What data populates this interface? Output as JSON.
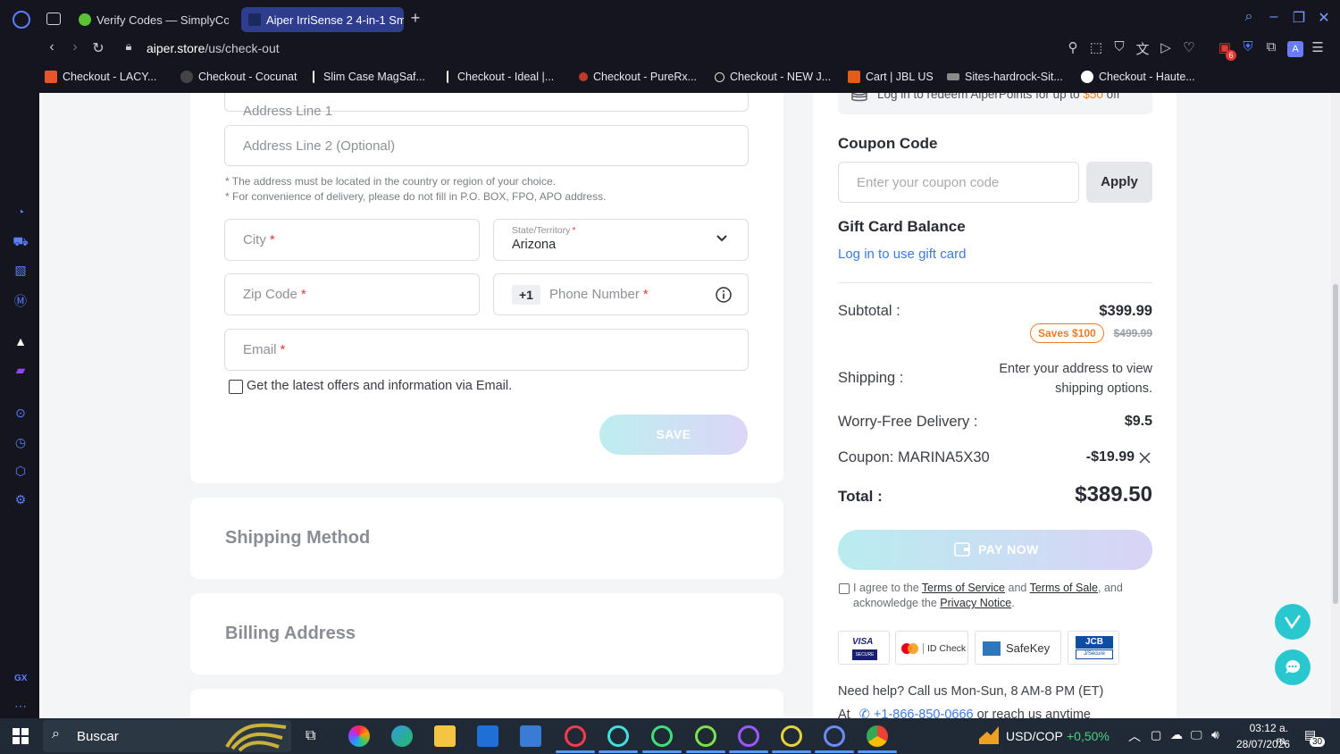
{
  "browser": {
    "tabs": [
      {
        "label": "Verify Codes — SimplyCod",
        "active": false
      },
      {
        "label": "Aiper IrriSense 2 4-in-1 Sm",
        "active": true
      }
    ],
    "url_host": "aiper.store",
    "url_path": "/us/check-out",
    "bookmarks": [
      "Checkout - LACY...",
      "Checkout - Cocunat",
      "Slim Case MagSaf...",
      "Checkout - Ideal |...",
      "Checkout - PureRx...",
      "Checkout - NEW J...",
      "Cart | JBL US",
      "Sites-hardrock-Sit...",
      "Checkout - Haute..."
    ],
    "ext_badge": "6",
    "profile": "A"
  },
  "form": {
    "address1_placeholder": "Address Line 1",
    "address2_placeholder": "Address Line 2 (Optional)",
    "note1": "* The address must be located in the country or region of your choice.",
    "note2": "* For convenience of delivery, please do not fill in P.O. BOX, FPO, APO address.",
    "city_placeholder": "City",
    "state_label": "State/Territory",
    "state_value": "Arizona",
    "zip_placeholder": "Zip Code",
    "phone_prefix": "+1",
    "phone_placeholder": "Phone Number",
    "email_placeholder": "Email",
    "required_mark": "*",
    "offers_label": "Get the latest offers and information via Email.",
    "save_label": "SAVE"
  },
  "sections": {
    "shipping_method": "Shipping Method",
    "billing_address": "Billing Address"
  },
  "summary": {
    "points_text_pre": "Log in to redeem AiperPoints for up to ",
    "points_amount": "$50",
    "points_text_post": " off",
    "coupon_title": "Coupon Code",
    "coupon_placeholder": "Enter your coupon code",
    "apply_label": "Apply",
    "gift_title": "Gift Card Balance",
    "gift_link": "Log in to use gift card",
    "subtotal_label": "Subtotal :",
    "subtotal_value": "$399.99",
    "saves_badge": "Saves $100",
    "original_price": "$499.99",
    "shipping_label": "Shipping :",
    "shipping_value": "Enter your address to view shipping options.",
    "worry_label": "Worry-Free Delivery :",
    "worry_value": "$9.5",
    "coupon_applied_label": "Coupon: MARINA5X30",
    "coupon_applied_value": "-$19.99",
    "total_label": "Total :",
    "total_value": "$389.50",
    "pay_label": "PAY NOW",
    "agree_pre": "I agree to the ",
    "terms_service": "Terms of Service",
    "agree_and": " and ",
    "terms_sale": "Terms of Sale",
    "agree_mid": ", and acknowledge the ",
    "privacy": "Privacy Notice",
    "agree_end": ".",
    "badges": [
      "VISA",
      "SECURE",
      "ID Check",
      "SafeKey",
      "JCB",
      "J/Secure"
    ],
    "help_text": "Need help? Call us Mon-Sun, 8 AM-8 PM (ET)",
    "help_at": "At",
    "phone": "+1-866-850-0666",
    "help_tail": " or reach us anytime"
  },
  "taskbar": {
    "search_label": "Buscar",
    "currency": "USD/COP",
    "currency_change": "+0,50%",
    "time": "03:12 a. m.",
    "date": "28/07/2026",
    "notif_count": "30"
  },
  "colors": {
    "accent": "#3d7bd8",
    "pay_gradient_start": "#b9ecef",
    "pay_gradient_end": "#d9d3f6",
    "saves": "#f47a20"
  }
}
